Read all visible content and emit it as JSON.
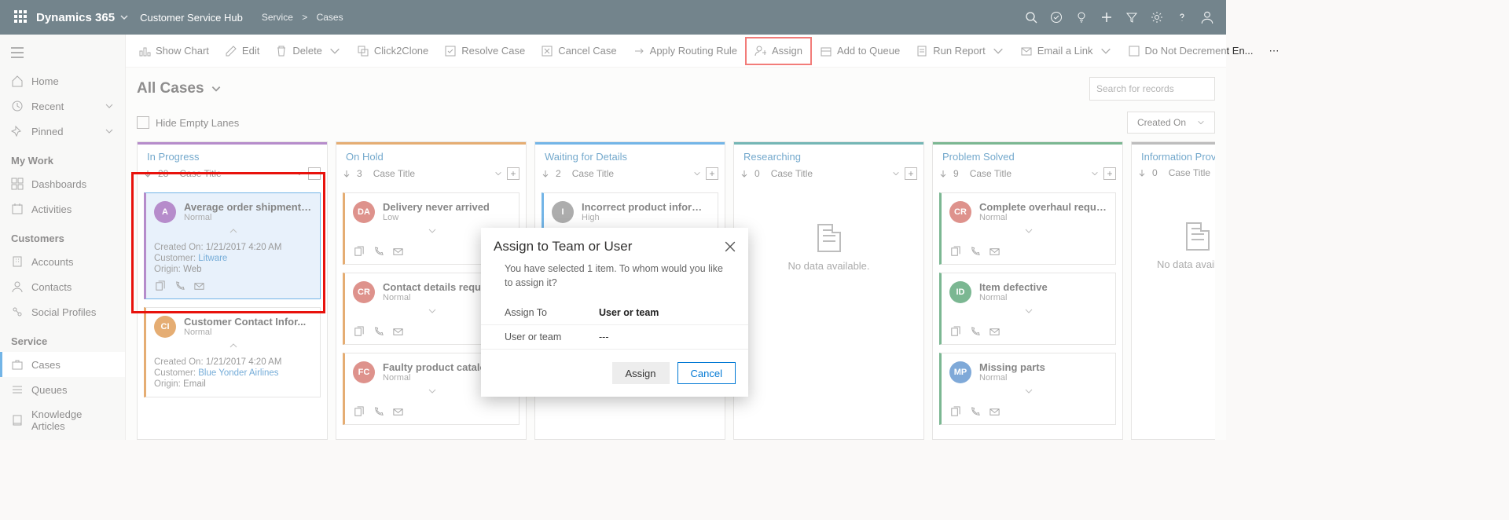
{
  "top": {
    "brand": "Dynamics 365",
    "hub": "Customer Service Hub",
    "bc1": "Service",
    "bc2": "Cases"
  },
  "cmds": {
    "showChart": "Show Chart",
    "edit": "Edit",
    "delete": "Delete",
    "click2clone": "Click2Clone",
    "resolve": "Resolve Case",
    "cancel": "Cancel Case",
    "routing": "Apply Routing Rule",
    "assign": "Assign",
    "queue": "Add to Queue",
    "runReport": "Run Report",
    "emailLink": "Email a Link",
    "noDecrement": "Do Not Decrement En..."
  },
  "nav": {
    "home": "Home",
    "recent": "Recent",
    "pinned": "Pinned",
    "g1": "My Work",
    "dashboards": "Dashboards",
    "activities": "Activities",
    "g2": "Customers",
    "accounts": "Accounts",
    "contacts": "Contacts",
    "social": "Social Profiles",
    "g3": "Service",
    "cases": "Cases",
    "queues": "Queues",
    "kb": "Knowledge Articles"
  },
  "view": {
    "title": "All Cases",
    "searchPH": "Search for records",
    "hideEmpty": "Hide Empty Lanes",
    "sort": "Created On"
  },
  "lanes": {
    "l1": {
      "name": "In Progress",
      "count": "28",
      "sort": "Case Title",
      "boxGlyph": "−"
    },
    "l2": {
      "name": "On Hold",
      "count": "3",
      "sort": "Case Title",
      "boxGlyph": "+"
    },
    "l3": {
      "name": "Waiting for Details",
      "count": "2",
      "sort": "Case Title",
      "boxGlyph": "+"
    },
    "l4": {
      "name": "Researching",
      "count": "0",
      "sort": "Case Title",
      "boxGlyph": "+",
      "empty": "No data available."
    },
    "l5": {
      "name": "Problem Solved",
      "count": "9",
      "sort": "Case Title",
      "boxGlyph": "+"
    },
    "l6": {
      "name": "Information Provided",
      "count": "0",
      "sort": "Case Title",
      "empty": "No data available."
    }
  },
  "cards": {
    "c1": {
      "avT": "A",
      "avC": "#7b2ea0",
      "title": "Average order shipment ...",
      "prio": "Normal",
      "m1k": "Created On:",
      "m1v": "1/21/2017 4:20 AM",
      "m2k": "Customer:",
      "m2v": "Litware",
      "m3k": "Origin:",
      "m3v": "Web"
    },
    "c2": {
      "avT": "CI",
      "avC": "#d06a00",
      "title": "Customer Contact Infor...",
      "prio": "Normal",
      "m1k": "Created On:",
      "m1v": "1/21/2017 4:20 AM",
      "m2k": "Customer:",
      "m2v": "Blue Yonder Airlines",
      "m3k": "Origin:",
      "m3v": "Email"
    },
    "c3": {
      "avT": "DA",
      "avC": "#c33a2f",
      "title": "Delivery never arrived",
      "prio": "Low"
    },
    "c4": {
      "avT": "CR",
      "avC": "#c33a2f",
      "title": "Contact details requested",
      "prio": "Normal"
    },
    "c5": {
      "avT": "FC",
      "avC": "#c33a2f",
      "title": "Faulty product catalog",
      "prio": "Normal"
    },
    "c6": {
      "avT": "I",
      "avC": "#6b6b6b",
      "title": "Incorrect product informa...",
      "prio": "High"
    },
    "c7": {
      "avT": "CR",
      "avC": "#c33a2f",
      "title": "Complete overhaul requi...",
      "prio": "Normal"
    },
    "c8": {
      "avT": "ID",
      "avC": "#0f7c3a",
      "title": "Item defective",
      "prio": "Normal"
    },
    "c9": {
      "avT": "MP",
      "avC": "#1763b8",
      "title": "Missing parts",
      "prio": "Normal"
    }
  },
  "modal": {
    "title": "Assign to Team or User",
    "desc": "You have selected 1 item. To whom would you like to assign it?",
    "f1k": "Assign To",
    "f1v": "User or team",
    "f2k": "User or team",
    "f2v": "---",
    "assign": "Assign",
    "cancel": "Cancel"
  }
}
